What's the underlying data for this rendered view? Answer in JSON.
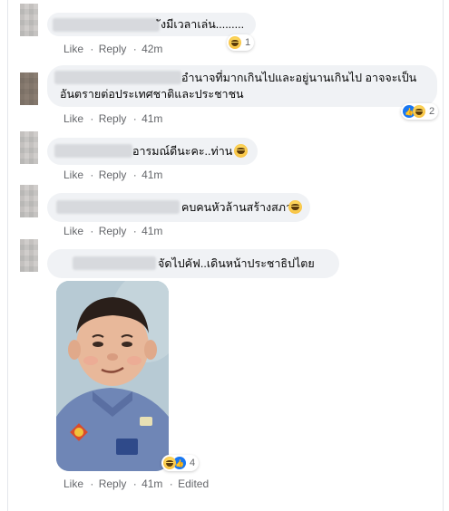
{
  "comments": [
    {
      "text": "ังมีเวลาเล่น.........",
      "reactions": {
        "icons": [
          "haha-icon"
        ],
        "count": "1"
      },
      "actions": {
        "like": "Like",
        "reply": "Reply",
        "time": "42m"
      }
    },
    {
      "text_line1": "อำนาจที่มากเกินไปและอยู่นานเกินไป อาจจะเป็น",
      "text_line2": "อันตรายต่อประเทศชาติและประชาชน",
      "reactions": {
        "icons": [
          "like-icon",
          "haha-icon"
        ],
        "count": "2"
      },
      "actions": {
        "like": "Like",
        "reply": "Reply",
        "time": "41m"
      }
    },
    {
      "text": "อารมณ์ดีนะคะ..ท่าน",
      "actions": {
        "like": "Like",
        "reply": "Reply",
        "time": "41m"
      }
    },
    {
      "text": "คบคนหัวล้านสร้างสภา",
      "actions": {
        "like": "Like",
        "reply": "Reply",
        "time": "41m"
      }
    },
    {
      "text": "จัดไปคัฟ..เดินหน้าประชาธิปไตย",
      "reactions": {
        "icons": [
          "haha-icon",
          "like-icon"
        ],
        "count": "4"
      },
      "actions": {
        "like": "Like",
        "reply": "Reply",
        "time": "41m",
        "edited": "Edited"
      }
    }
  ],
  "sep": "·"
}
